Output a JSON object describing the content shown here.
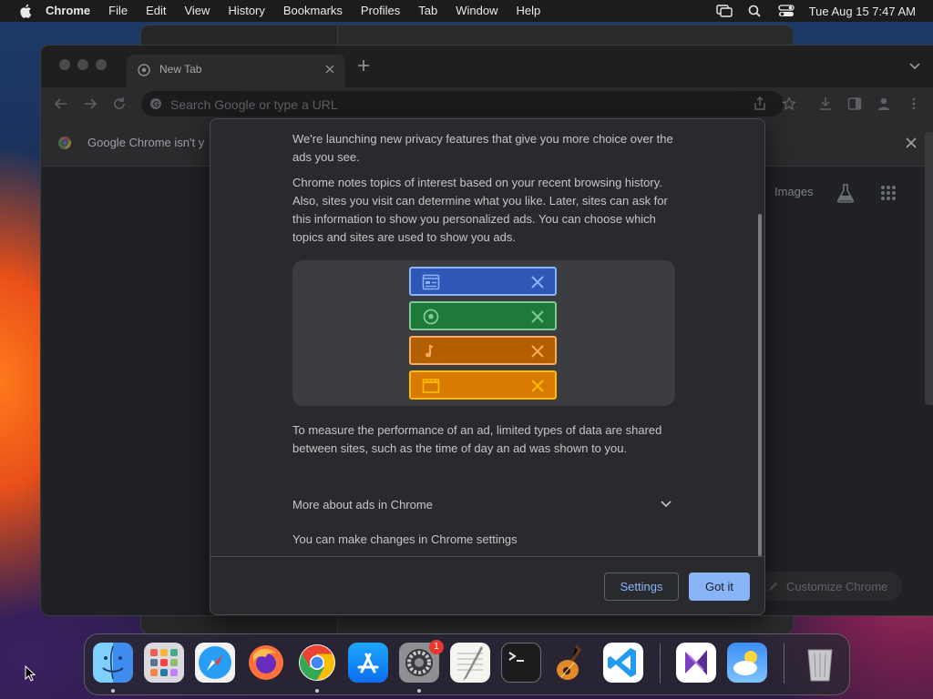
{
  "menubar": {
    "app": "Chrome",
    "items": [
      "File",
      "Edit",
      "View",
      "History",
      "Bookmarks",
      "Profiles",
      "Tab",
      "Window",
      "Help"
    ],
    "clock": "Tue Aug 15  7:47 AM"
  },
  "browser": {
    "tab_title": "New Tab",
    "omnibox_placeholder": "Search Google or type a URL",
    "infobar_text": "Google Chrome isn't y",
    "ntp_images": "Images",
    "customize_label": "Customize Chrome"
  },
  "dialog": {
    "intro": "We're launching new privacy features that give you more choice over the ads you see.",
    "topics_paragraph": "Chrome notes topics of interest based on your recent browsing history. Also, sites you visit can determine what you like. Later, sites can ask for this information to show you personalized ads. You can choose which topics and sites are used to show you ads.",
    "measurement_paragraph": "To measure the performance of an ad, limited types of data are shared between sites, such as the time of day an ad was shown to you.",
    "more_label": "More about ads in Chrome",
    "settings_note": "You can make changes in Chrome settings",
    "settings_button": "Settings",
    "got_it_button": "Got it",
    "illustration_rows": [
      {
        "icon": "browser-window-icon",
        "color": "#2f57b8",
        "border": "#8ab4f8"
      },
      {
        "icon": "soccer-ball-icon",
        "color": "#1e7a3a",
        "border": "#81c995"
      },
      {
        "icon": "music-note-icon",
        "color": "#b35f00",
        "border": "#f6ae5c"
      },
      {
        "icon": "film-clapper-icon",
        "color": "#d97a00",
        "border": "#fbbc04"
      }
    ]
  },
  "dock": {
    "items": [
      "Finder",
      "Launchpad",
      "Safari",
      "Firefox",
      "Chrome",
      "App Store",
      "System Settings",
      "TextEdit",
      "Terminal",
      "GarageBand",
      "Visual Studio Code",
      "Visual Studio",
      "Weather",
      "Trash"
    ],
    "system_settings_badge": "1"
  },
  "colors": {
    "accent": "#8ab4f8",
    "dialog_bg": "#292a2d",
    "window_bg": "#202124"
  }
}
